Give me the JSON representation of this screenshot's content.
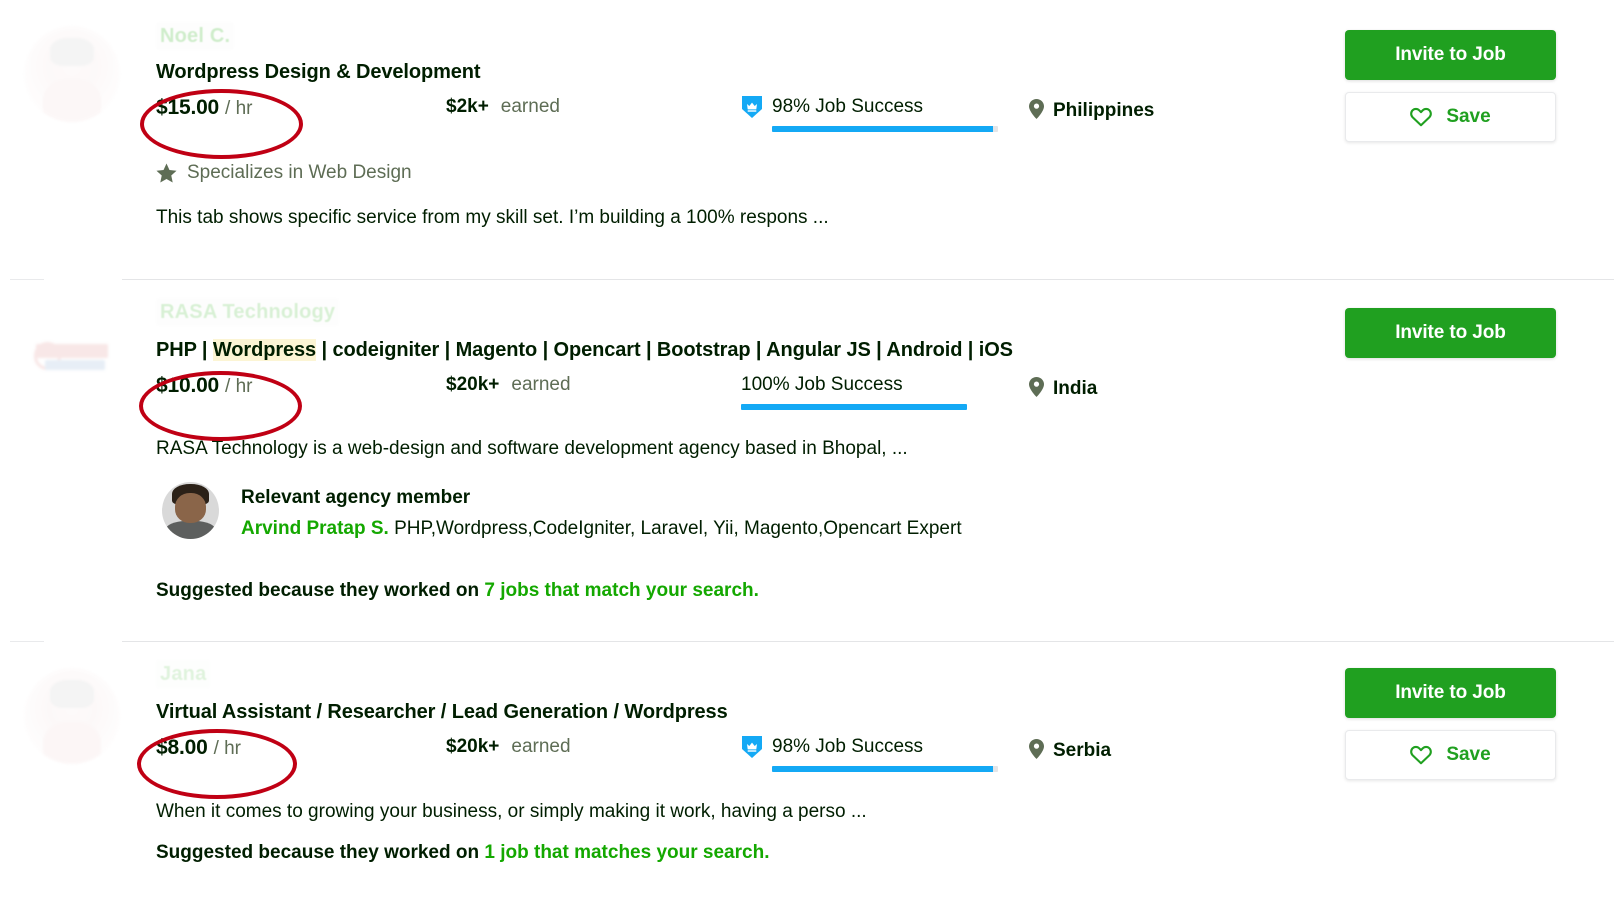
{
  "colors": {
    "brand_green": "#14a800",
    "button_green": "#20A020",
    "jss_blue": "#14a9f5",
    "annotation_red": "#c00014",
    "highlight_yellow": "#fcf5d4",
    "muted_text": "#5e6d55",
    "divider": "#e4e5e7"
  },
  "actions": {
    "invite_label": "Invite to Job",
    "save_label": "Save",
    "heart_icon": "heart-icon"
  },
  "labels": {
    "earned_suffix": "earned",
    "rate_per": "/ hr",
    "job_success_suffix": "Job Success",
    "suggested_prefix": "Suggested because they worked on ",
    "relevant_agency_member": "Relevant agency member",
    "star_icon": "star-icon",
    "location_icon": "location-pin-icon",
    "jss_badge_icon": "job-success-badge-icon"
  },
  "results": [
    {
      "freelancer_name": "Noel C.",
      "title": "Wordpress Design & Development",
      "title_highlight": "",
      "rate_amount": "$15.00",
      "rate_per": "/ hr",
      "earned_amount": "$2k+",
      "earned_label": "earned",
      "job_success": "98% Job Success",
      "job_success_value": 98,
      "has_jss_badge": true,
      "location": "Philippines",
      "specializes": "Specializes in Web Design",
      "description": "This tab shows specific service from my skill set. I’m building a 100% respons ...",
      "has_save_button": true,
      "agency_member": null,
      "suggested": null,
      "avatar_kind": "photo"
    },
    {
      "freelancer_name": "RASA Technology",
      "title_parts": [
        {
          "text": "PHP | ",
          "highlight": false
        },
        {
          "text": "Wordpress",
          "highlight": true
        },
        {
          "text": " | codeigniter | Magento | Opencart | Bootstrap | Angular JS | Android | iOS",
          "highlight": false
        }
      ],
      "rate_amount": "$10.00",
      "rate_per": "/ hr",
      "earned_amount": "$20k+",
      "earned_label": "earned",
      "job_success": "100% Job Success",
      "job_success_value": 100,
      "has_jss_badge": false,
      "location": "India",
      "specializes": null,
      "description": "RASA Technology is a web-design and software development agency based in Bhopal, ...",
      "has_save_button": false,
      "agency_member": {
        "heading": "Relevant agency member",
        "name": "Arvind Pratap S.",
        "tagline": "PHP,Wordpress,CodeIgniter, Laravel, Yii, Magento,Opencart Expert"
      },
      "suggested": {
        "prefix": "Suggested because they worked on ",
        "link": "7 jobs that match your search."
      },
      "avatar_kind": "logo"
    },
    {
      "freelancer_name": "Jana",
      "title": "Virtual Assistant / Researcher / Lead Generation / Wordpress",
      "title_highlight": "",
      "rate_amount": "$8.00",
      "rate_per": "/ hr",
      "earned_amount": "$20k+",
      "earned_label": "earned",
      "job_success": "98% Job Success",
      "job_success_value": 98,
      "has_jss_badge": true,
      "location": "Serbia",
      "specializes": null,
      "description": "When it comes to growing your business, or simply making it work, having a perso ...",
      "has_save_button": true,
      "agency_member": null,
      "suggested": {
        "prefix": "Suggested because they worked on ",
        "link": "1 job that matches your search."
      },
      "avatar_kind": "photo"
    }
  ]
}
